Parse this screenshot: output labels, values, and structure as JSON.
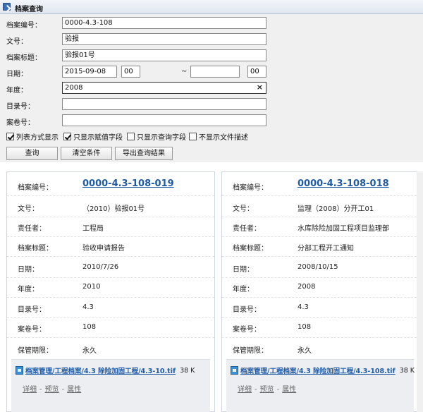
{
  "window": {
    "title": "档案查询"
  },
  "form": {
    "archive_no_label": "档案编号：",
    "archive_no_value": "0000-4.3-108",
    "doc_no_label": "文号：",
    "doc_no_value": "验报",
    "archive_title_label": "档案标题：",
    "archive_title_value": "验报01号",
    "date_label": "日期：",
    "date_from": "2015-09-08",
    "date_from_hour": "00",
    "date_sep": "~",
    "date_to": "",
    "date_to_hour": "00",
    "year_label": "年度：",
    "year_value": "2008",
    "year_clear": "×",
    "catalog_no_label": "目录号：",
    "catalog_no_value": "",
    "volume_no_label": "案卷号：",
    "volume_no_value": ""
  },
  "options": [
    {
      "label": "列表方式显示",
      "checked": true
    },
    {
      "label": "只显示赋值字段",
      "checked": true
    },
    {
      "label": "只显示查询字段",
      "checked": false
    },
    {
      "label": "不显示文件描述",
      "checked": false
    }
  ],
  "buttons": {
    "query": "查询",
    "clear": "清空条件",
    "export": "导出查询结果"
  },
  "results": [
    {
      "fields": [
        {
          "key": "档案编号：",
          "value": "0000-4.3-108-019"
        },
        {
          "key": "文号：",
          "value": "（2010）验报01号"
        },
        {
          "key": "责任者：",
          "value": "工程局"
        },
        {
          "key": "档案标题：",
          "value": "验收申请报告"
        },
        {
          "key": "日期：",
          "value": "2010/7/26"
        },
        {
          "key": "年度：",
          "value": "2010"
        },
        {
          "key": "目录号：",
          "value": "4.3"
        },
        {
          "key": "案卷号：",
          "value": "108"
        },
        {
          "key": "保管期限：",
          "value": "永久"
        }
      ],
      "file": {
        "path": "档案管理/工程档案/4.3 除险加固工程/4.3-10.tif",
        "size": "38 K"
      },
      "links": [
        "详细",
        "预览",
        "属性"
      ]
    },
    {
      "fields": [
        {
          "key": "档案编号：",
          "value": "0000-4.3-108-018"
        },
        {
          "key": "文号：",
          "value": "监理（2008）分开工01"
        },
        {
          "key": "责任者：",
          "value": "水库除险加固工程项目监理部"
        },
        {
          "key": "档案标题：",
          "value": "分部工程开工通知"
        },
        {
          "key": "日期：",
          "value": "2008/10/15"
        },
        {
          "key": "年度：",
          "value": "2008"
        },
        {
          "key": "目录号：",
          "value": "4.3"
        },
        {
          "key": "案卷号：",
          "value": "108"
        },
        {
          "key": "保管期限：",
          "value": "永久"
        }
      ],
      "file": {
        "path": "档案管理/工程档案/4.3 除险加固工程/4.3-108.tif",
        "size": "38 K"
      },
      "links": [
        "详细",
        "预览",
        "属性"
      ]
    }
  ]
}
